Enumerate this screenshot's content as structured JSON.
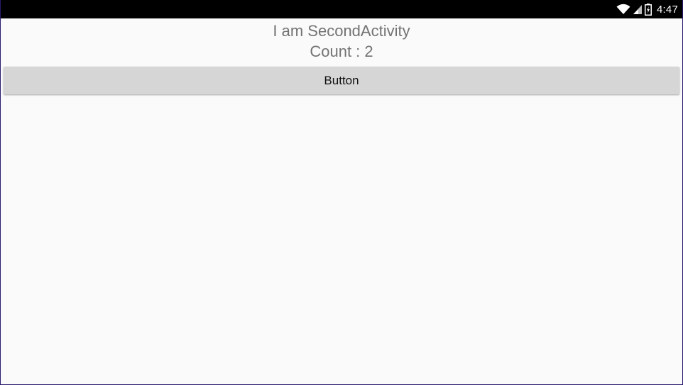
{
  "status_bar": {
    "time": "4:47",
    "icons": [
      "wifi-icon",
      "signal-icon",
      "battery-icon"
    ],
    "background": "#000000"
  },
  "activity": {
    "title": "I am SecondActivity",
    "count_text": "Count : 2"
  },
  "button": {
    "label": "Button",
    "background": "#d6d6d6"
  },
  "colors": {
    "screen_background": "#fafafa",
    "text_gray": "#737373"
  }
}
